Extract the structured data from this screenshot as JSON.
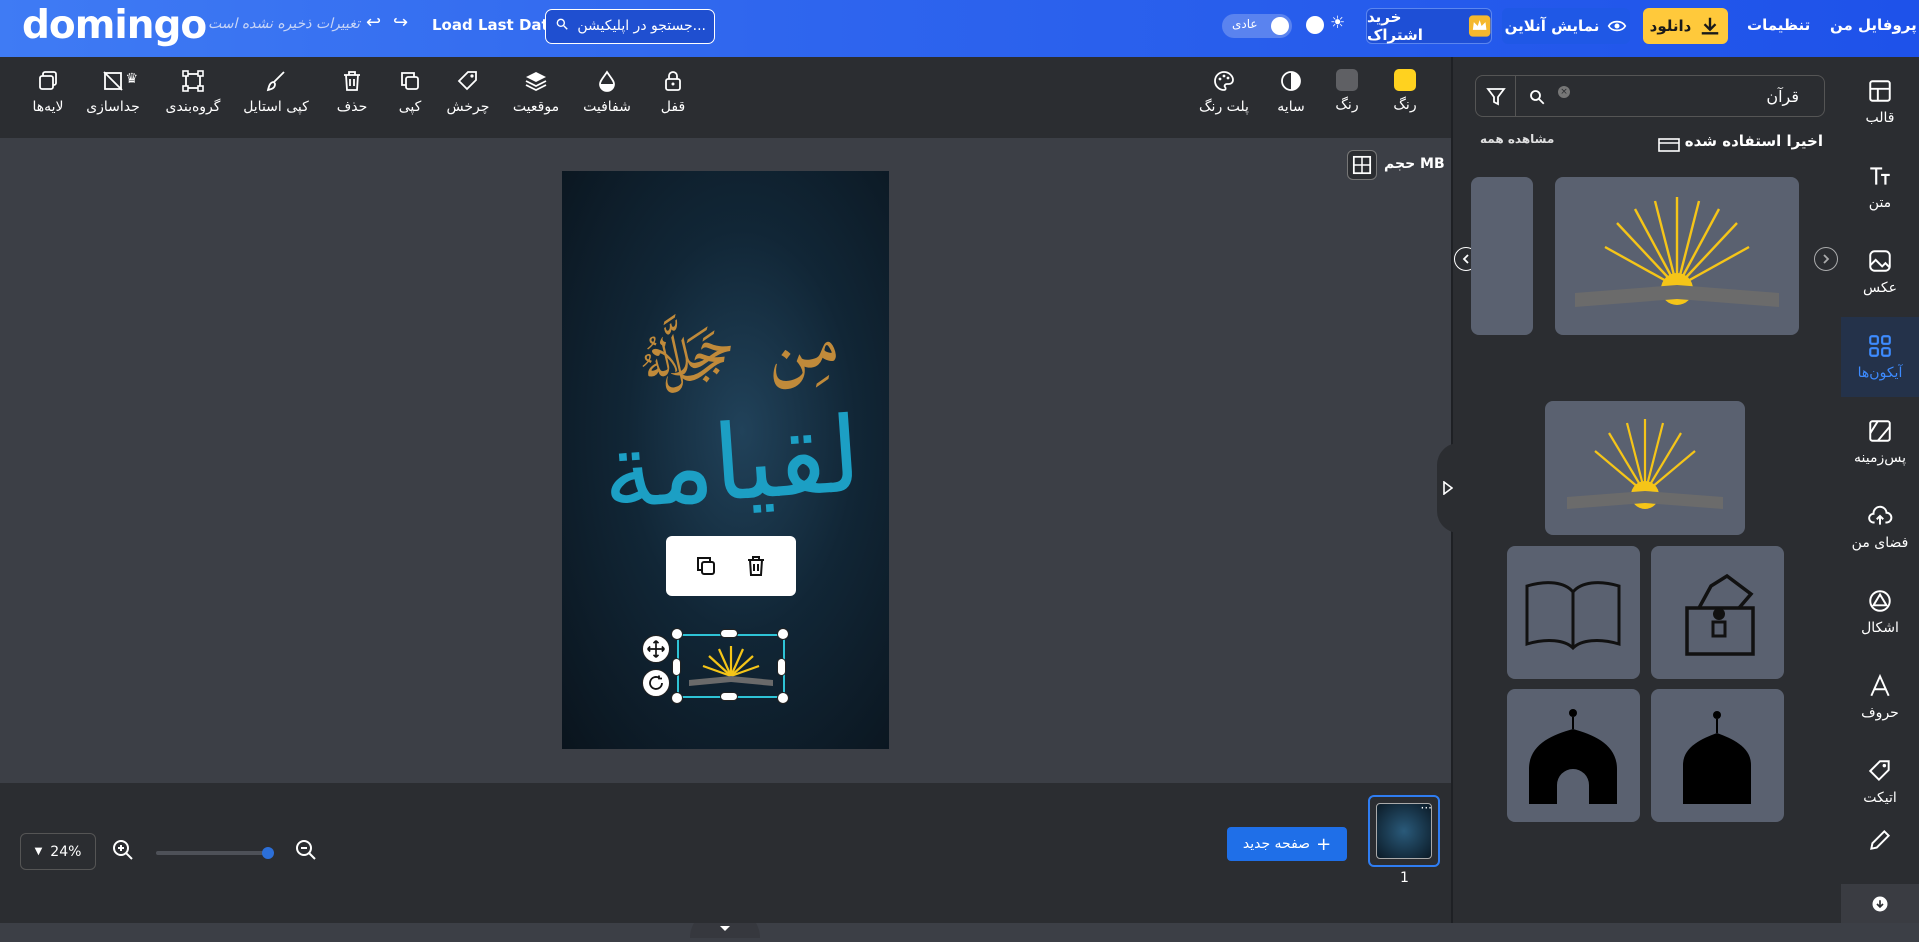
{
  "topbar": {
    "logo": "domingo",
    "unsaved": "تغییرات ذخیره نشده است",
    "load_last": "Load Last Data",
    "search_placeholder": "جستجو در اپلیکیشن...",
    "mode_label": "عادی",
    "subscribe": "خرید اشتراک",
    "online_preview": "نمایش آنلاین",
    "download": "دانلود",
    "settings": "تنظیمات",
    "profile": "پروفایل من",
    "accent": "#2f66ee",
    "download_color": "#ffc93b"
  },
  "toolbar": {
    "layers": "لایه‌ها",
    "separate": "جداسازی",
    "group": "گروه‌بندی",
    "copy_style": "کپی استایل",
    "delete": "حذف",
    "copy": "کپی",
    "rotate": "چرخش",
    "position": "موقعیت",
    "opacity": "شفافیت",
    "lock": "قفل",
    "palette": "پلت رنگ",
    "shadow": "سایه",
    "color2": "رنگ",
    "color1": "رنگ",
    "swatch1": "#ffd21f",
    "swatch2": "#5f6064"
  },
  "canvas": {
    "size_label": "حجم MB"
  },
  "bottom": {
    "zoom": "24%",
    "zoom_level": 0.92,
    "new_page": "صفحه جدید",
    "page_number": "1",
    "thumb_more": "···"
  },
  "panel": {
    "search_value": "قرآن",
    "recent_title": "اخیرا استفاده شده",
    "view_all": "مشاهده همه"
  },
  "nav": {
    "template": "قالب",
    "text": "متن",
    "photo": "عکس",
    "icons": "آیکون‌ها",
    "background": "پس‌زمینه",
    "my_space": "فضای من",
    "shapes": "اشکال",
    "letters": "حروف",
    "sticker": "اتیکت",
    "drawing": ""
  }
}
